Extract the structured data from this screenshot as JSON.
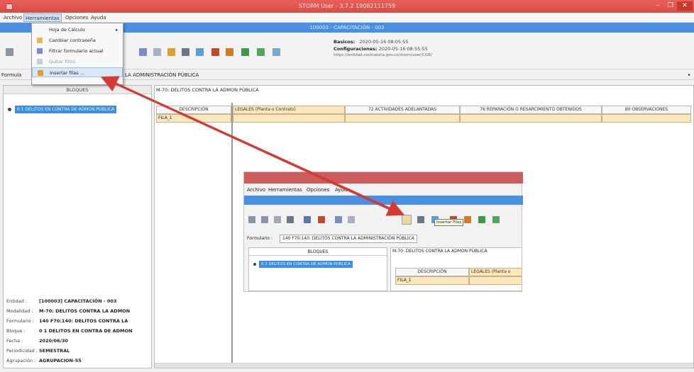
{
  "window": {
    "title": "STORM User - 3.7.2 19082111759",
    "minimize": "–",
    "maximize": "❐",
    "close": "✕"
  },
  "menu": [
    "Archivo",
    "Herramientas",
    "Opciones",
    "Ayuda"
  ],
  "infobar": {
    "text": "100003 - CAPACITACIÓN - 003"
  },
  "config": {
    "basicos_label": "Basicos:",
    "basicos_value": "2020-05-16 08:05:55",
    "config_label": "Configuraciones:",
    "config_value": "2020-05-16 08:55:55",
    "url": "https://entidad.contraloria.gov.co/storm/user/CGR/"
  },
  "formbar": {
    "label": "Formula",
    "value": "LA ADMINISTRACIÓN PÚBLICA"
  },
  "dropdown": [
    {
      "label": "Hoja de Cálculo",
      "submenu": "▸"
    },
    {
      "label": "Cambiar contraseña"
    },
    {
      "label": "Filtrar formulario actual"
    },
    {
      "label": "Quitar filtro"
    },
    {
      "label": "Insertar filas ..."
    }
  ],
  "left_panel": {
    "header": "BLOQUES",
    "tree_node": "0 1 DELITOS EN CONTRA DE ADMON PUBLICA",
    "info": [
      {
        "label": "Entidad :",
        "value": "[100003] CAPACITACIÓN - 003"
      },
      {
        "label": "Modalidad :",
        "value": "M-70: DELITOS CONTRA LA ADMON"
      },
      {
        "label": "Formulario :",
        "value": "140 F70:140: DELITOS CONTRA LA"
      },
      {
        "label": "Bloque :",
        "value": "0 1 DELITOS EN CONTRA DE ADMON"
      },
      {
        "label": "Fecha :",
        "value": "2020/06/30"
      },
      {
        "label": "Periodicidad :",
        "value": "SEMESTRAL"
      },
      {
        "label": "Agrupación :",
        "value": "AGRUPACION-55"
      }
    ]
  },
  "right_panel": {
    "header": "M-70: DELITOS CONTRA LA ADMON PÚBLICA",
    "columns": [
      "DESCRIPCIÓN",
      "LEGALES (Planta o Contrato)",
      "72 ACTIVIDADES ADELANTADAS",
      "76 REPARACIÓN O RESARCIMIENTO OBTENIDOS",
      "80 OBSERVACIONES"
    ],
    "row_label": "FILA_1"
  },
  "inset": {
    "menu": [
      "Archivo",
      "Herramientas",
      "Opciones",
      "Ayuda"
    ],
    "tooltip": "Insertar Filas",
    "form_label": "Formulario :",
    "form_value": "140 F70:140: DELITOS CONTRA LA ADMINISTRACIÓN PÚBLICA",
    "blocks_header": "BLOQUES",
    "grid_header": "M-70: DELITOS CONTRA LA ADMON PÚBLICA",
    "tree_node": "0 1 DELITOS EN CONTRA DE ADMON PUBLICA",
    "col1": "DESCRIPCIÓN",
    "col2": "LEGALES (Planta o",
    "row_label": "FILA_1"
  },
  "colors": {
    "title_red": "#d84c47",
    "accent_blue": "#4a90e2",
    "cell_orange": "#fbe7bd",
    "arrow": "#d23a33"
  }
}
